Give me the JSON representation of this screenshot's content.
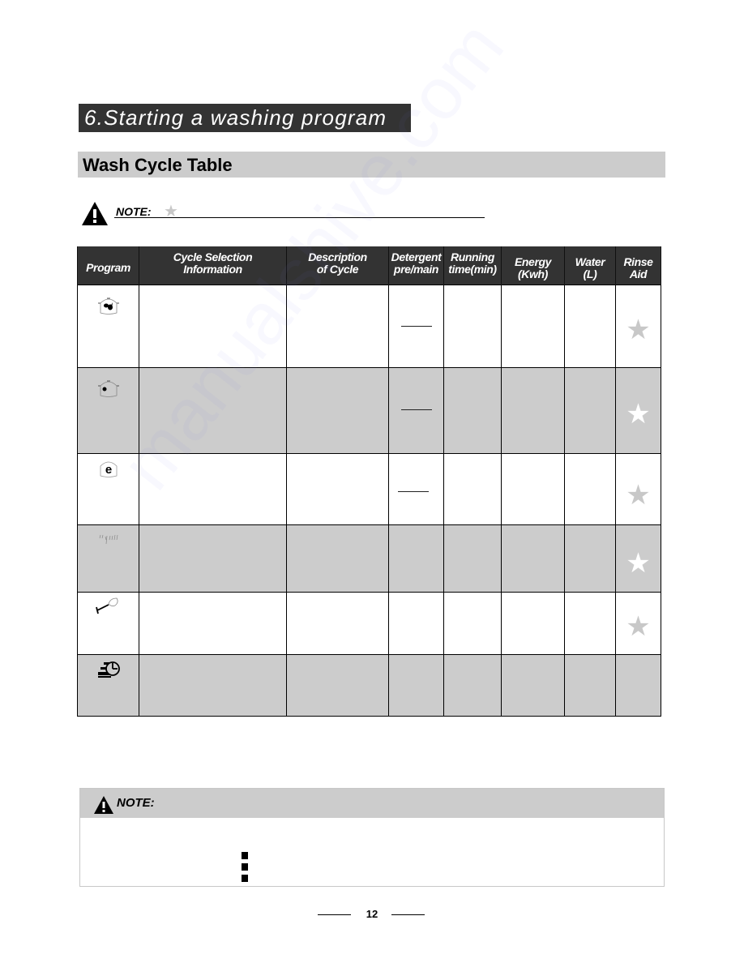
{
  "section": {
    "title": "6.Starting a washing program"
  },
  "subsection": {
    "title": "Wash Cycle Table"
  },
  "top_note": {
    "label": "NOTE:",
    "icon": "warning-icon",
    "symbol": "star-icon",
    "symbol_char": "★"
  },
  "table": {
    "headers": [
      "Program",
      "Cycle Selection Information",
      "Description of Cycle",
      "Detergent pre/main",
      "Running time(min)",
      "Energy (Kwh)",
      "Water (L)",
      "Rinse Aid"
    ],
    "rows": [
      {
        "program_icon": "intensive-pot-icon",
        "shaded": false,
        "detergent_dash": true,
        "rinse_aid_star": "gray"
      },
      {
        "program_icon": "normal-pot-icon",
        "shaded": true,
        "detergent_dash": true,
        "rinse_aid_star": "white"
      },
      {
        "program_icon": "eco-icon",
        "shaded": false,
        "detergent_dash": true,
        "rinse_aid_star": "gray"
      },
      {
        "program_icon": "glass-spray-icon",
        "shaded": true,
        "detergent_dash": false,
        "rinse_aid_star": "white"
      },
      {
        "program_icon": "wine-glass-icon",
        "shaded": false,
        "detergent_dash": false,
        "rinse_aid_star": "gray"
      },
      {
        "program_icon": "quick-clock-icon",
        "shaded": true,
        "detergent_dash": false,
        "rinse_aid_star": "none"
      }
    ],
    "star_char": "★"
  },
  "bottom_note": {
    "label": "NOTE:",
    "bullet_count": 3
  },
  "footer": {
    "page_number": "12"
  },
  "watermark": {
    "text": "manualshive.com"
  },
  "colors": {
    "title_bar": "#333333",
    "subtitle_bar": "#cccccc",
    "shaded_row": "#cccccc",
    "star_gray": "#c8c8c8",
    "star_white": "#ffffff"
  }
}
